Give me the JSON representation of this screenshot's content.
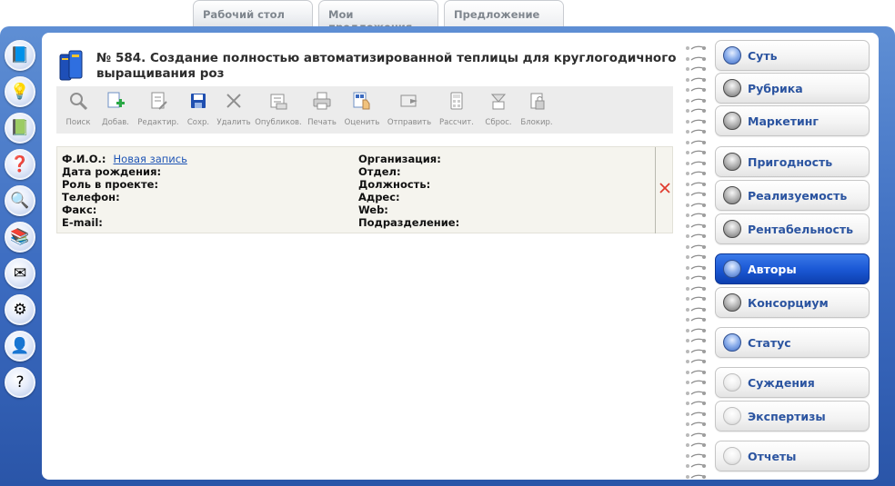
{
  "tabs": [
    {
      "label": "Рабочий стол",
      "active": false
    },
    {
      "label": "Мои предложения",
      "active": false
    },
    {
      "label": "Предложение",
      "active": true
    }
  ],
  "page": {
    "title": "№ 584. Создание полностью автоматизированной теплицы для круглогодичного выращивания роз"
  },
  "toolbar": [
    {
      "label": "Поиск",
      "icon": "magnifier-icon",
      "enabled": false
    },
    {
      "label": "Добав.",
      "icon": "add-document-icon",
      "enabled": true
    },
    {
      "label": "Редактир.",
      "icon": "edit-document-icon",
      "enabled": false
    },
    {
      "label": "Сохр.",
      "icon": "floppy-disk-icon",
      "enabled": true
    },
    {
      "label": "Удалить",
      "icon": "delete-x-icon",
      "enabled": false
    },
    {
      "label": "Опубликов.",
      "icon": "publish-icon",
      "enabled": false
    },
    {
      "label": "Печать",
      "icon": "printer-icon",
      "enabled": false
    },
    {
      "label": "Оценить",
      "icon": "rate-hand-icon",
      "enabled": true
    },
    {
      "label": "Отправить",
      "icon": "send-icon",
      "enabled": false
    },
    {
      "label": "Рассчит.",
      "icon": "calculator-icon",
      "enabled": false
    },
    {
      "label": "Сброс.",
      "icon": "reset-icon",
      "enabled": false
    },
    {
      "label": "Блокир.",
      "icon": "lock-icon",
      "enabled": false
    }
  ],
  "author_card": {
    "left_fields": [
      {
        "label": "Ф.И.О.:",
        "value": "Новая запись"
      },
      {
        "label": "Дата рождения:",
        "value": ""
      },
      {
        "label": "Роль в проекте:",
        "value": ""
      },
      {
        "label": "Телефон:",
        "value": ""
      },
      {
        "label": "Факс:",
        "value": ""
      },
      {
        "label": "E-mail:",
        "value": ""
      }
    ],
    "right_fields": [
      {
        "label": "Организация:",
        "value": ""
      },
      {
        "label": "Отдел:",
        "value": ""
      },
      {
        "label": "Должность:",
        "value": ""
      },
      {
        "label": "Адрес:",
        "value": ""
      },
      {
        "label": "Web:",
        "value": ""
      },
      {
        "label": "Подразделение:",
        "value": ""
      }
    ]
  },
  "nav": [
    {
      "label": "Суть",
      "dot": "blue",
      "active": false
    },
    {
      "label": "Рубрика",
      "dot": "gray",
      "active": false
    },
    {
      "label": "Маркетинг",
      "dot": "gray",
      "active": false
    },
    {
      "label": "Пригодность",
      "dot": "gray",
      "active": false
    },
    {
      "label": "Реализуемость",
      "dot": "gray",
      "active": false
    },
    {
      "label": "Рентабельность",
      "dot": "gray",
      "active": false
    },
    {
      "label": "Авторы",
      "dot": "blue",
      "active": true
    },
    {
      "label": "Консорциум",
      "dot": "gray",
      "active": false
    },
    {
      "label": "Статус",
      "dot": "blue",
      "active": false
    },
    {
      "label": "Суждения",
      "dot": "light",
      "active": false
    },
    {
      "label": "Экспертизы",
      "dot": "light",
      "active": false
    },
    {
      "label": "Отчеты",
      "dot": "light",
      "active": false
    }
  ],
  "left_icons": [
    {
      "icon": "proposal-book-icon",
      "glyph": "📘"
    },
    {
      "icon": "idea-icon",
      "glyph": "💡"
    },
    {
      "icon": "question-book-icon",
      "glyph": "📗"
    },
    {
      "icon": "help-question-icon",
      "glyph": "❓"
    },
    {
      "icon": "search-document-icon",
      "glyph": "🔍"
    },
    {
      "icon": "books-icon",
      "glyph": "📚"
    },
    {
      "icon": "mail-icon",
      "glyph": "✉"
    },
    {
      "icon": "settings-icon",
      "glyph": "⚙"
    },
    {
      "icon": "user-icon",
      "glyph": "👤"
    },
    {
      "icon": "help-icon",
      "glyph": "?"
    }
  ],
  "colors": {
    "frame_blue": "#3b6bc0",
    "nav_text": "#2b54a0",
    "nav_active": "#1b59d6",
    "link": "#1f55b5",
    "delete_red": "#e03b2e"
  }
}
